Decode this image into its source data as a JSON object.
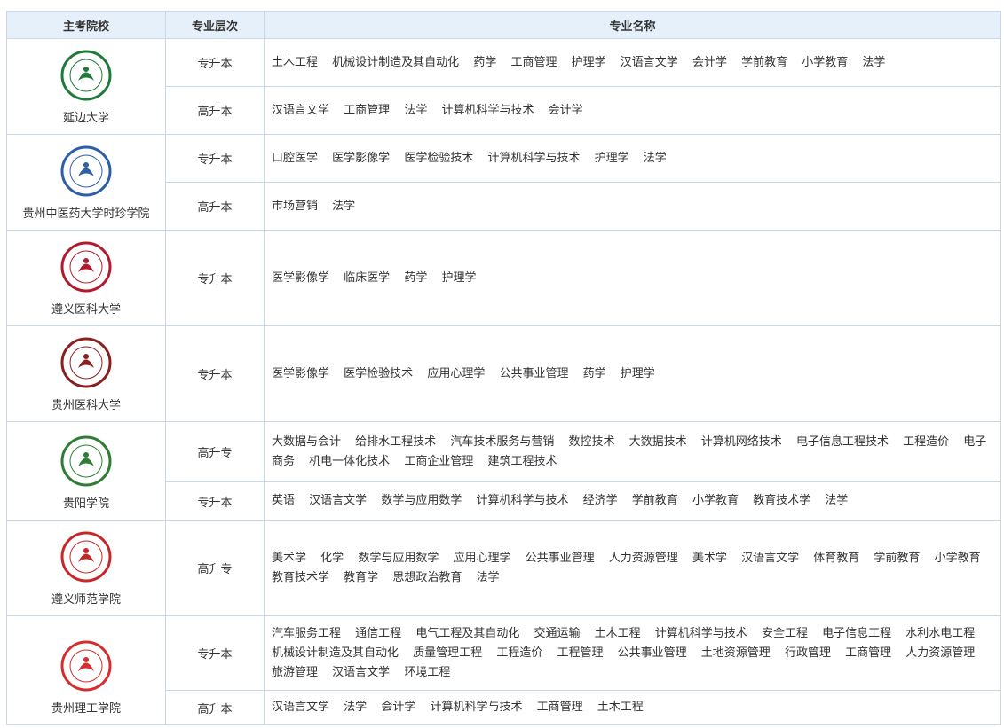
{
  "headers": {
    "school": "主考院校",
    "level": "专业层次",
    "major": "专业名称"
  },
  "schools": [
    {
      "name": "延边大学",
      "logo_icon": "yanbian-university-logo",
      "logo_color": "#1f7a3c",
      "rows": [
        {
          "level": "专升本",
          "majors": [
            "土木工程",
            "机械设计制造及其自动化",
            "药学",
            "工商管理",
            "护理学",
            "汉语言文学",
            "会计学",
            "学前教育",
            "小学教育",
            "法学"
          ]
        },
        {
          "level": "高升本",
          "majors": [
            "汉语言文学",
            "工商管理",
            "法学",
            "计算机科学与技术",
            "会计学"
          ]
        }
      ]
    },
    {
      "name": "贵州中医药大学时珍学院",
      "logo_icon": "shizhen-college-logo",
      "logo_color": "#2b5fa8",
      "rows": [
        {
          "level": "专升本",
          "majors": [
            "口腔医学",
            "医学影像学",
            "医学检验技术",
            "计算机科学与技术",
            "护理学",
            "法学"
          ]
        },
        {
          "level": "高升本",
          "majors": [
            "市场营销",
            "法学"
          ]
        }
      ]
    },
    {
      "name": "遵义医科大学",
      "logo_icon": "zunyi-medical-logo",
      "logo_color": "#b01c2e",
      "rows": [
        {
          "level": "专升本",
          "majors": [
            "医学影像学",
            "临床医学",
            "药学",
            "护理学"
          ]
        }
      ]
    },
    {
      "name": "贵州医科大学",
      "logo_icon": "guizhou-medical-logo",
      "logo_color": "#8a1f1f",
      "rows": [
        {
          "level": "专升本",
          "majors": [
            "医学影像学",
            "医学检验技术",
            "应用心理学",
            "公共事业管理",
            "药学",
            "护理学"
          ]
        }
      ]
    },
    {
      "name": "贵阳学院",
      "logo_icon": "guiyang-university-logo",
      "logo_color": "#2e7d32",
      "rows": [
        {
          "level": "高升专",
          "majors": [
            "大数据与会计",
            "给排水工程技术",
            "汽车技术服务与营销",
            "数控技术",
            "大数据技术",
            "计算机网络技术",
            "电子信息工程技术",
            "工程造价",
            "电子商务",
            "机电一体化技术",
            "工商企业管理",
            "建筑工程技术"
          ]
        },
        {
          "level": "专升本",
          "majors": [
            "英语",
            "汉语言文学",
            "数学与应用数学",
            "计算机科学与技术",
            "经济学",
            "学前教育",
            "小学教育",
            "教育技术学",
            "法学"
          ]
        }
      ]
    },
    {
      "name": "遵义师范学院",
      "logo_icon": "zunyi-normal-logo",
      "logo_color": "#c62828",
      "rows": [
        {
          "level": "高升专",
          "majors": [
            "美术学",
            "化学",
            "数学与应用数学",
            "应用心理学",
            "公共事业管理",
            "人力资源管理",
            "美术学",
            "汉语言文学",
            "体育教育",
            "学前教育",
            "小学教育",
            "教育技术学",
            "教育学",
            "思想政治教育",
            "法学"
          ]
        }
      ]
    },
    {
      "name": "贵州理工学院",
      "logo_icon": "guizhou-tech-logo",
      "logo_color": "#d32f2f",
      "rows": [
        {
          "level": "专升本",
          "majors": [
            "汽车服务工程",
            "通信工程",
            "电气工程及其自动化",
            "交通运输",
            "土木工程",
            "计算机科学与技术",
            "安全工程",
            "电子信息工程",
            "水利水电工程",
            "机械设计制造及其自动化",
            "质量管理工程",
            "工程造价",
            "工程管理",
            "公共事业管理",
            "土地资源管理",
            "行政管理",
            "工商管理",
            "人力资源管理",
            "旅游管理",
            "汉语言文学",
            "环境工程"
          ]
        },
        {
          "level": "高升本",
          "majors": [
            "汉语言文学",
            "法学",
            "会计学",
            "计算机科学与技术",
            "工商管理",
            "土木工程"
          ]
        }
      ]
    }
  ]
}
